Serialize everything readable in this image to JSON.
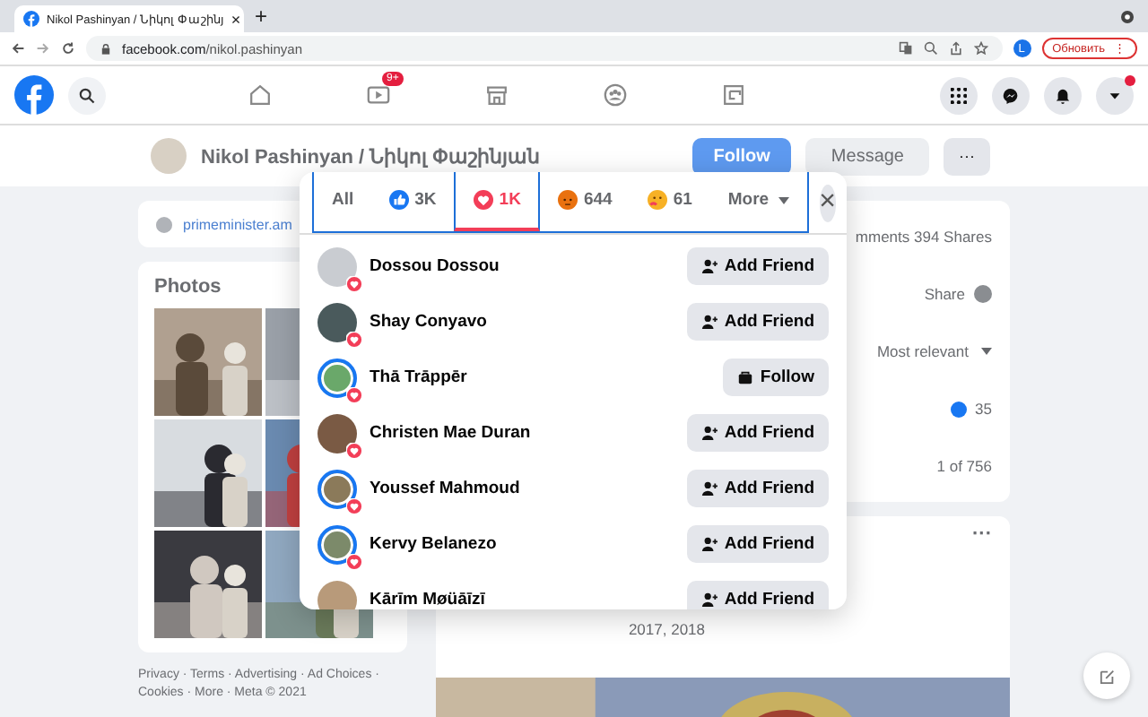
{
  "browser": {
    "tab_title": "Nikol Pashinyan / Նիկոլ Փաշինյ",
    "tab_close": "×",
    "new_tab": "+",
    "url_host": "facebook.com",
    "url_path": "/nikol.pashinyan",
    "profile_initial": "L",
    "update_button": "Обновить",
    "update_menu": "⋮"
  },
  "nav": {
    "video_badge": "9+",
    "notification_dot": true
  },
  "profile": {
    "name": "Nikol Pashinyan / Նիկոլ Փաշինյան",
    "follow": "Follow",
    "message": "Message",
    "more": "···"
  },
  "intro": {
    "website": "primeminister.am"
  },
  "photos": {
    "title": "Photos"
  },
  "footer": "Privacy · Terms · Advertising · Ad Choices · Cookies · More · Meta © 2021",
  "post": {
    "stats": "mments 394 Shares",
    "share": "Share",
    "sort": "Most relevant",
    "likes": "35",
    "pager": "1 of 756",
    "more": "···",
    "footer_year_text": "2017, 2018"
  },
  "reactions": {
    "tabs": [
      {
        "kind": "all",
        "label": "All",
        "selected": false
      },
      {
        "kind": "like",
        "label": "3K",
        "selected": false
      },
      {
        "kind": "love",
        "label": "1K",
        "selected": true
      },
      {
        "kind": "angry",
        "label": "644",
        "selected": false
      },
      {
        "kind": "care",
        "label": "61",
        "selected": false
      },
      {
        "kind": "more",
        "label": "More",
        "selected": false
      }
    ],
    "close": "×",
    "people": [
      {
        "name": "Dossou Dossou",
        "story": false,
        "kind": "add_friend",
        "button": "Add Friend"
      },
      {
        "name": "Shay Conyavo",
        "story": false,
        "kind": "add_friend",
        "button": "Add Friend"
      },
      {
        "name": "Thā Trāppēr",
        "story": true,
        "kind": "follow",
        "button": "Follow"
      },
      {
        "name": "Christen Mae Duran",
        "story": false,
        "kind": "add_friend",
        "button": "Add Friend"
      },
      {
        "name": "Youssef Mahmoud",
        "story": true,
        "kind": "add_friend",
        "button": "Add Friend"
      },
      {
        "name": "Kervy Belanezo",
        "story": true,
        "kind": "add_friend",
        "button": "Add Friend"
      },
      {
        "name": "Kārīm Møüāīzī",
        "story": false,
        "kind": "add_friend",
        "button": "Add Friend"
      }
    ]
  }
}
